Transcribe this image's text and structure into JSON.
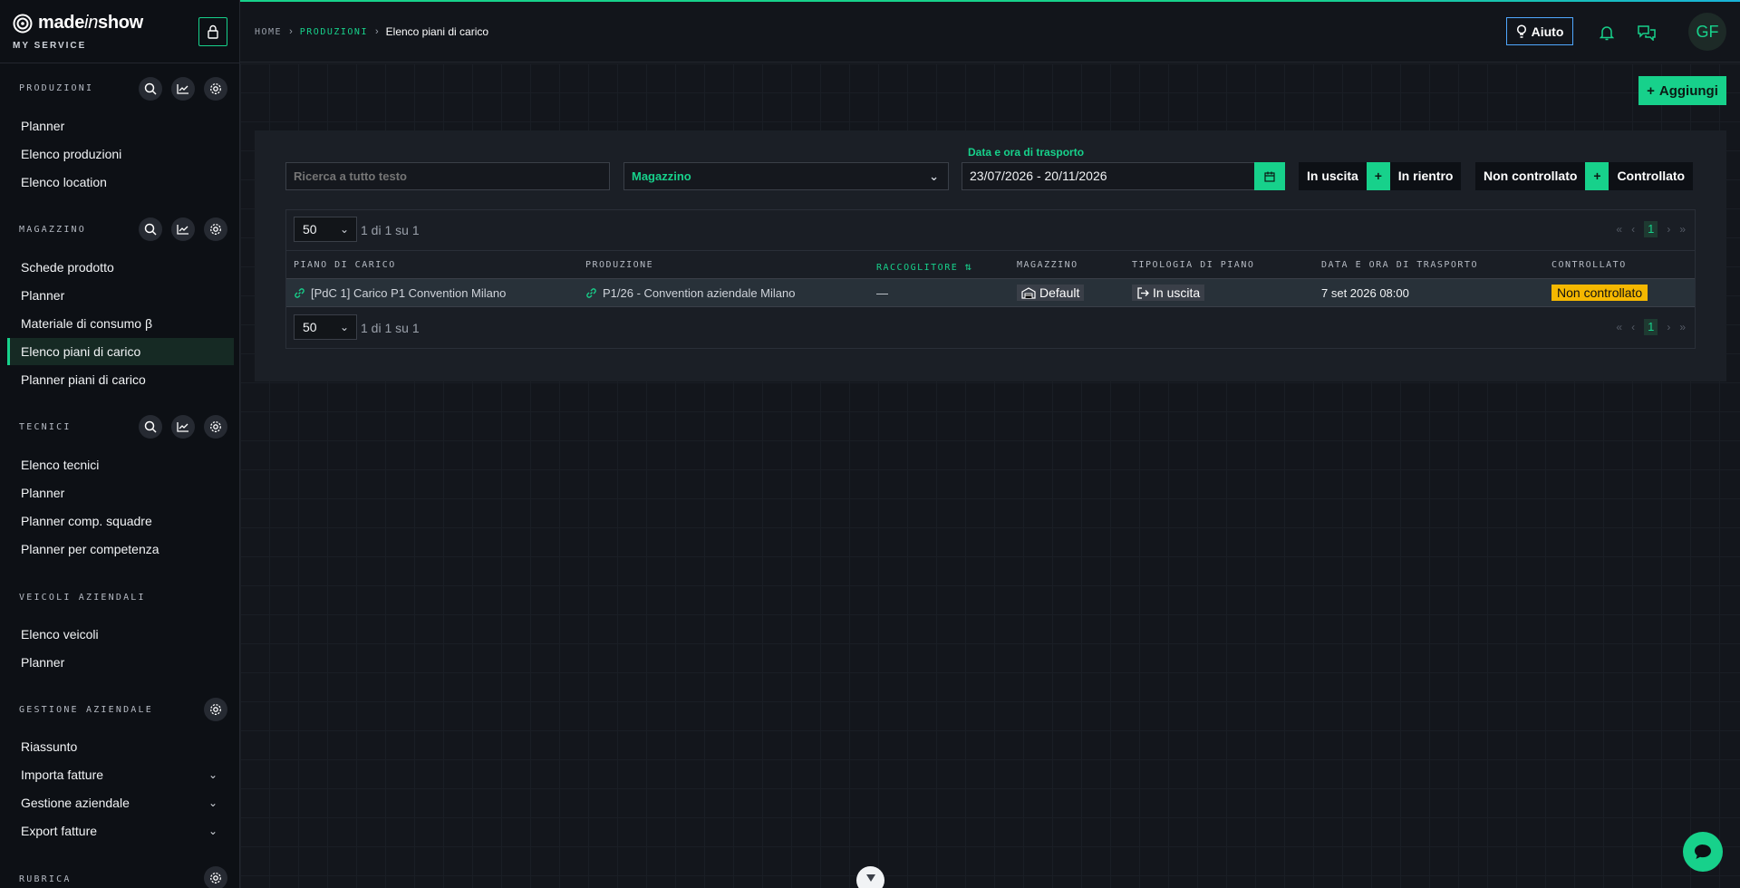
{
  "brand": {
    "name_main": "made",
    "name_italic": "in",
    "name_end": "show",
    "subtitle": "MY SERVICE"
  },
  "sidebar": {
    "sections": [
      {
        "title": "PRODUZIONI",
        "tools": [
          "search-icon",
          "chart-icon",
          "gear-icon"
        ],
        "items": [
          {
            "label": "Planner"
          },
          {
            "label": "Elenco produzioni"
          },
          {
            "label": "Elenco location"
          }
        ]
      },
      {
        "title": "MAGAZZINO",
        "tools": [
          "search-icon",
          "chart-icon",
          "gear-icon"
        ],
        "items": [
          {
            "label": "Schede prodotto"
          },
          {
            "label": "Planner"
          },
          {
            "label": "Materiale di consumo β"
          },
          {
            "label": "Elenco piani di carico",
            "active": true
          },
          {
            "label": "Planner piani di carico"
          }
        ]
      },
      {
        "title": "TECNICI",
        "tools": [
          "search-icon",
          "chart-icon",
          "gear-icon"
        ],
        "items": [
          {
            "label": "Elenco tecnici"
          },
          {
            "label": "Planner"
          },
          {
            "label": "Planner comp. squadre"
          },
          {
            "label": "Planner per competenza"
          }
        ]
      },
      {
        "title": "VEICOLI AZIENDALI",
        "tools": [],
        "items": [
          {
            "label": "Elenco veicoli"
          },
          {
            "label": "Planner"
          }
        ]
      },
      {
        "title": "GESTIONE AZIENDALE",
        "tools": [
          "gear-icon"
        ],
        "items": [
          {
            "label": "Riassunto"
          },
          {
            "label": "Importa fatture",
            "expandable": true
          },
          {
            "label": "Gestione aziendale",
            "expandable": true
          },
          {
            "label": "Export fatture",
            "expandable": true
          }
        ]
      },
      {
        "title": "RUBRICA",
        "tools": [
          "gear-icon"
        ],
        "items": []
      }
    ]
  },
  "header": {
    "breadcrumb": {
      "home": "HOME",
      "section": "PRODUZIONI",
      "current": "Elenco piani di carico"
    },
    "help_label": "Aiuto",
    "avatar_initials": "GF"
  },
  "toolbar": {
    "add_label": "Aggiungi"
  },
  "filters": {
    "search_placeholder": "Ricerca a tutto testo",
    "warehouse_label": "Magazzino",
    "date_label": "Data e ora di trasporto",
    "date_value": "23/07/2026 - 20/11/2026",
    "direction_out": "In uscita",
    "direction_in": "In rientro",
    "check_no": "Non controllato",
    "check_yes": "Controllato",
    "plus": "+"
  },
  "table": {
    "page_size": "50",
    "page_info": "1 di 1 su 1",
    "current_page": "1",
    "columns": [
      "PIANO DI CARICO",
      "PRODUZIONE",
      "RACCOGLITORE",
      "MAGAZZINO",
      "TIPOLOGIA DI PIANO",
      "DATA E ORA DI TRASPORTO",
      "CONTROLLATO"
    ],
    "rows": [
      {
        "piano": "[PdC 1] Carico P1 Convention Milano",
        "produzione": "P1/26 - Convention aziendale Milano",
        "raccoglitore": "—",
        "magazzino": "Default",
        "tipologia": "In uscita",
        "data": "7 set 2026 08:00",
        "controllato": "Non controllato"
      }
    ]
  },
  "colors": {
    "accent": "#17d18b",
    "warning": "#f5b800",
    "help_border": "#4fa7ff"
  }
}
